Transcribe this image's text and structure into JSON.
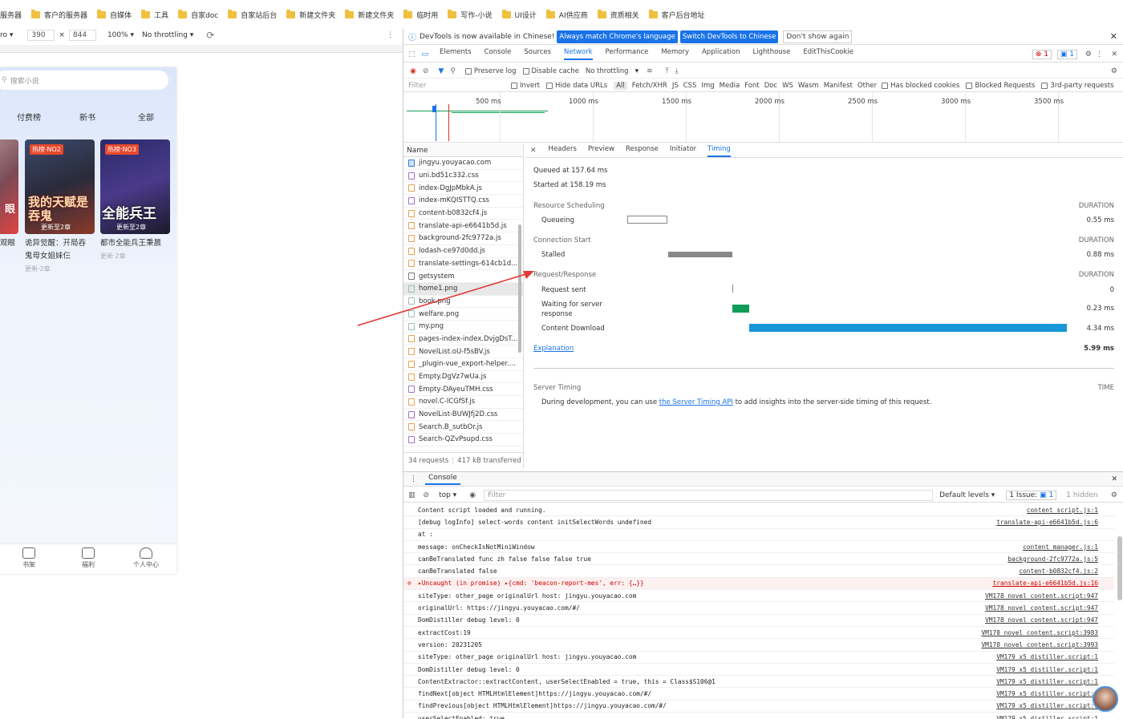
{
  "bookmarks": [
    "服务器",
    "客户的服务器",
    "自媒体",
    "工具",
    "自家doc",
    "自家站后台",
    "新建文件夹",
    "新建文件夹",
    "临时用",
    "写作-小说",
    "UI设计",
    "AI供应商",
    "资质相关",
    "客户后台地址"
  ],
  "device": {
    "preset": "ro ▾",
    "width": "390",
    "x": "×",
    "height": "844",
    "zoom": "100% ▾",
    "throttle": "No throttling ▾"
  },
  "phone": {
    "search_placeholder": "搜索小说",
    "tabs": [
      "付费榜",
      "新书",
      "全部"
    ],
    "books": [
      {
        "tag": "热榜·NO2",
        "cover_title": "我的天赋是吞鬼",
        "cover_sub": "更新至2章",
        "title_line1": "诡异觉醒：开局吞",
        "title_line2": "鬼母女姐妹仨",
        "update": "更新·2章"
      },
      {
        "tag": "热榜·NO3",
        "cover_title": "全能兵王",
        "cover_sub": "更新至2章",
        "title_line1": "都市全能兵王秉晨",
        "title_line2": "",
        "update": "更新·2章"
      }
    ],
    "left_partial": {
      "cover": "眼",
      "title": "观眼"
    },
    "nav": [
      "书架",
      "福利",
      "个人中心"
    ]
  },
  "devtools": {
    "info_text": "DevTools is now available in Chinese!",
    "btn_match": "Always match Chrome's language",
    "btn_switch": "Switch DevTools to Chinese",
    "btn_dont": "Don't show again",
    "tabs": [
      "Elements",
      "Console",
      "Sources",
      "Network",
      "Performance",
      "Memory",
      "Application",
      "Lighthouse",
      "EditThisCookie"
    ],
    "active_tab": "Network",
    "errors": "1",
    "issues": "1",
    "preserve_log": "Preserve log",
    "disable_cache": "Disable cache",
    "throttling": "No throttling",
    "filter_placeholder": "Filter",
    "filter_opts": [
      "Invert",
      "Hide data URLs"
    ],
    "types": [
      "All",
      "Fetch/XHR",
      "JS",
      "CSS",
      "Img",
      "Media",
      "Font",
      "Doc",
      "WS",
      "Wasm",
      "Manifest",
      "Other"
    ],
    "blocked_cookies": "Has blocked cookies",
    "blocked_requests": "Blocked Requests",
    "third_party": "3rd-party requests",
    "ticks": [
      "500 ms",
      "1000 ms",
      "1500 ms",
      "2000 ms",
      "2500 ms",
      "3000 ms",
      "3500 ms"
    ],
    "name_header": "Name",
    "requests": [
      {
        "n": "jingyu.youyacao.com",
        "t": "doc"
      },
      {
        "n": "uni.bd51c332.css",
        "t": "css"
      },
      {
        "n": "index-DgJpMbkA.js",
        "t": "js"
      },
      {
        "n": "index-mKQISTTQ.css",
        "t": "css"
      },
      {
        "n": "content-b0832cf4.js",
        "t": "js"
      },
      {
        "n": "translate-api-e6641b5d.js",
        "t": "js"
      },
      {
        "n": "background-2fc9772a.js",
        "t": "js"
      },
      {
        "n": "lodash-ce97d0dd.js",
        "t": "js"
      },
      {
        "n": "translate-settings-614cb1d...",
        "t": "js"
      },
      {
        "n": "getsystem",
        "t": "xhr"
      },
      {
        "n": "home1.png",
        "t": "img"
      },
      {
        "n": "book.png",
        "t": "img"
      },
      {
        "n": "welfare.png",
        "t": "img"
      },
      {
        "n": "my.png",
        "t": "img"
      },
      {
        "n": "pages-index-index.DvjgDsT...",
        "t": "js"
      },
      {
        "n": "NovelList.oU-f5sBV.js",
        "t": "js"
      },
      {
        "n": "_plugin-vue_export-helper....",
        "t": "js"
      },
      {
        "n": "Empty.DgVz7wUa.js",
        "t": "js"
      },
      {
        "n": "Empty-DAyeuTMH.css",
        "t": "css"
      },
      {
        "n": "novel.C-lCGfSf.js",
        "t": "js"
      },
      {
        "n": "NovelList-BUWJfj2D.css",
        "t": "css"
      },
      {
        "n": "Search.B_sutbOr.js",
        "t": "js"
      },
      {
        "n": "Search-QZvPsupd.css",
        "t": "css"
      }
    ],
    "summary_requests": "34 requests",
    "summary_transfer": "417 kB transferred",
    "detail_tabs": [
      "Headers",
      "Preview",
      "Response",
      "Initiator",
      "Timing"
    ],
    "active_detail": "Timing",
    "timing": {
      "queued": "Queued at 157.64 ms",
      "started": "Started at 158.19 ms",
      "duration": "DURATION",
      "resource_scheduling": "Resource Scheduling",
      "queueing": "Queueing",
      "queueing_val": "0.55 ms",
      "connection_start": "Connection Start",
      "stalled": "Stalled",
      "stalled_val": "0.88 ms",
      "req_resp": "Request/Response",
      "request_sent": "Request sent",
      "request_sent_val": "0",
      "waiting_1": "Waiting for server",
      "waiting_2": "response",
      "waiting_val": "0.23 ms",
      "content_download": "Content Download",
      "content_val": "4.34 ms",
      "explanation": "Explanation",
      "total": "5.99 ms",
      "server_timing": "Server Timing",
      "time": "TIME",
      "server_text_1": "During development, you can use ",
      "server_link": "the Server Timing API",
      "server_text_2": " to add insights into the server-side timing of this request."
    },
    "console": {
      "title": "Console",
      "context": "top ▾",
      "filter": "Filter",
      "levels": "Default levels ▾",
      "issue_label": "1 Issue:",
      "issue_count": "1",
      "hidden": "1 hidden",
      "lines": [
        {
          "m": "Content script loaded and running.",
          "s": "content_script.js:1"
        },
        {
          "m": "[debug logInfo] select-words content initSelectWords undefined",
          "s": "translate-api-e6641b5d.js:6"
        },
        {
          "m": "at  :",
          "s": ""
        },
        {
          "m": "message: onCheckIsNotMiniWindow",
          "s": "content_manager.js:1"
        },
        {
          "m": "canBeTranslated func zh false false false true",
          "s": "background-2fc9772a.js:5"
        },
        {
          "m": "canBeTranslated false",
          "s": "content-b0832cf4.js:2"
        },
        {
          "m": "▸Uncaught (in promise) ▸{cmd: 'beacon-report-mes', err: {…}}",
          "s": "translate-api-e6641b5d.js:16",
          "err": true
        },
        {
          "m": "siteType: other_page originalUrl host: jingyu.youyacao.com",
          "s": "VM178 novel_content.script:947"
        },
        {
          "m": "originalUrl: https://jingyu.youyacao.com/#/",
          "s": "VM178 novel_content.script:947"
        },
        {
          "m": "DomDistiller debug level: 0",
          "s": "VM178 novel_content.script:947"
        },
        {
          "m": "extractCost:19",
          "s": "VM178 novel_content.script:3983"
        },
        {
          "m": "version: 20231205",
          "s": "VM178 novel_content.script:3993"
        },
        {
          "m": "siteType: other_page originalUrl host: jingyu.youyacao.com",
          "s": "VM179 x5_distiller.script:1"
        },
        {
          "m": "DomDistiller debug level: 0",
          "s": "VM179 x5_distiller.script:1"
        },
        {
          "m": "ContentExtractor::extractContent, userSelectEnabled = true, this = Class$S106@1",
          "s": "VM179 x5_distiller.script:1"
        },
        {
          "m": "findNext[object HTMLHtmlElement]https://jingyu.youyacao.com/#/",
          "s": "VM179 x5_distiller.script:1"
        },
        {
          "m": "findPrevious[object HTMLHtmlElement]https://jingyu.youyacao.com/#/",
          "s": "VM179 x5_distiller.script:1"
        },
        {
          "m": "userSelectEnabled: true",
          "s": "VM179 x5_distiller.script:1"
        }
      ]
    }
  },
  "colors": {
    "accent": "#1a73e8",
    "waiting": "#0f9d58",
    "download": "#1a95d8",
    "error": "#d93025"
  }
}
